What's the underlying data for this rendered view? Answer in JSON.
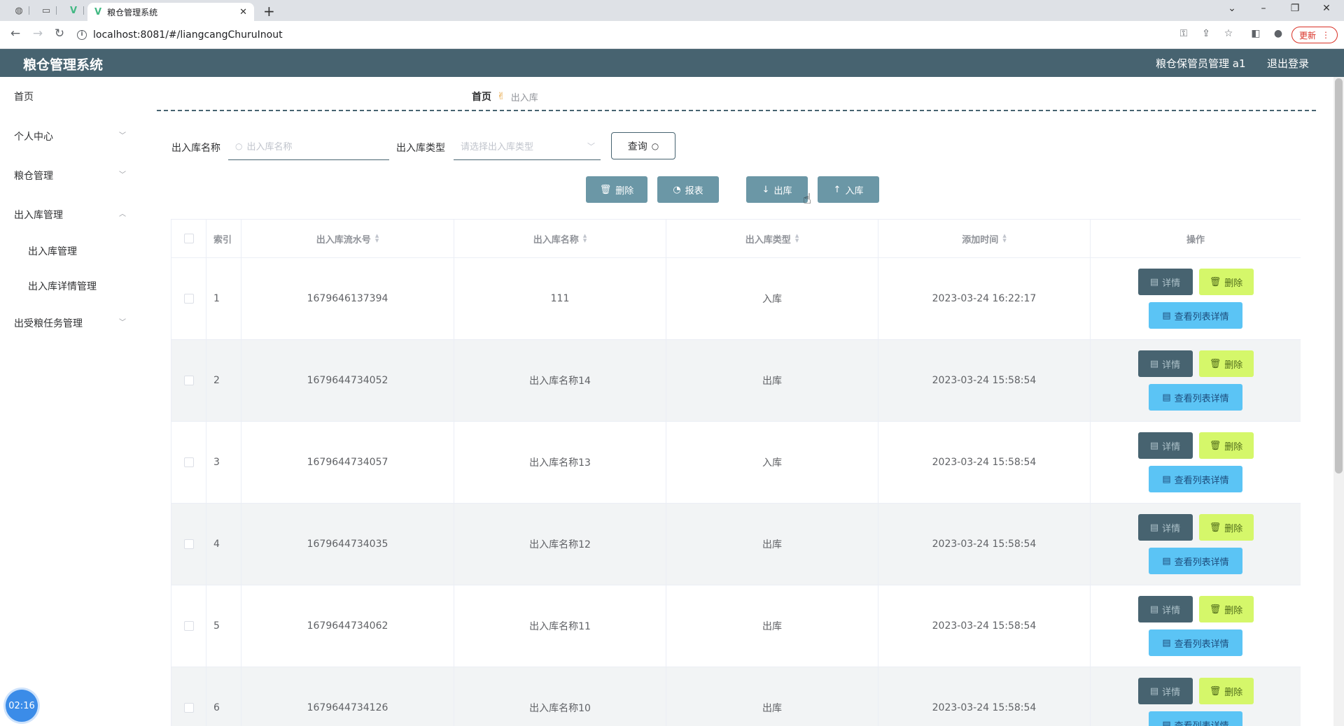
{
  "browser": {
    "tab_title": "粮仓管理系统",
    "url": "localhost:8081/#/liangcangChuruInout",
    "update_label": "更新"
  },
  "header": {
    "app_title": "粮仓管理系统",
    "user_label": "粮仓保管员管理 a1",
    "logout_label": "退出登录"
  },
  "sidebar": {
    "items": [
      {
        "label": "首页"
      },
      {
        "label": "个人中心"
      },
      {
        "label": "粮仓管理"
      },
      {
        "label": "出入库管理"
      },
      {
        "label": "出受粮任务管理"
      }
    ],
    "subitems": [
      {
        "label": "出入库管理"
      },
      {
        "label": "出入库详情管理"
      }
    ]
  },
  "breadcrumb": {
    "home": "首页",
    "current": "出入库"
  },
  "search": {
    "name_label": "出入库名称",
    "name_placeholder": "出入库名称",
    "type_label": "出入库类型",
    "type_placeholder": "请选择出入库类型",
    "query_label": "查询"
  },
  "actions": {
    "delete_label": "删除",
    "report_label": "报表",
    "out_label": "出库",
    "in_label": "入库"
  },
  "table": {
    "headers": {
      "index": "索引",
      "serial": "出入库流水号",
      "name": "出入库名称",
      "type": "出入库类型",
      "time": "添加时间",
      "ops": "操作"
    },
    "buttons": {
      "detail": "详情",
      "delete": "删除",
      "list_detail": "查看列表详情"
    },
    "rows": [
      {
        "index": "1",
        "serial": "1679646137394",
        "name": "111",
        "type": "入库",
        "time": "2023-03-24 16:22:17"
      },
      {
        "index": "2",
        "serial": "1679644734052",
        "name": "出入库名称14",
        "type": "出库",
        "time": "2023-03-24 15:58:54"
      },
      {
        "index": "3",
        "serial": "1679644734057",
        "name": "出入库名称13",
        "type": "入库",
        "time": "2023-03-24 15:58:54"
      },
      {
        "index": "4",
        "serial": "1679644734035",
        "name": "出入库名称12",
        "type": "出库",
        "time": "2023-03-24 15:58:54"
      },
      {
        "index": "5",
        "serial": "1679644734062",
        "name": "出入库名称11",
        "type": "出库",
        "time": "2023-03-24 15:58:54"
      },
      {
        "index": "6",
        "serial": "1679644734126",
        "name": "出入库名称10",
        "type": "出库",
        "time": "2023-03-24 15:58:54"
      }
    ]
  },
  "clock": "02:16",
  "colors": {
    "header_bg": "#476370",
    "action_btn": "#6b97a6",
    "detail_btn": "#476370",
    "delete_btn": "#d5f76a",
    "list_btn": "#5bc4f5"
  }
}
